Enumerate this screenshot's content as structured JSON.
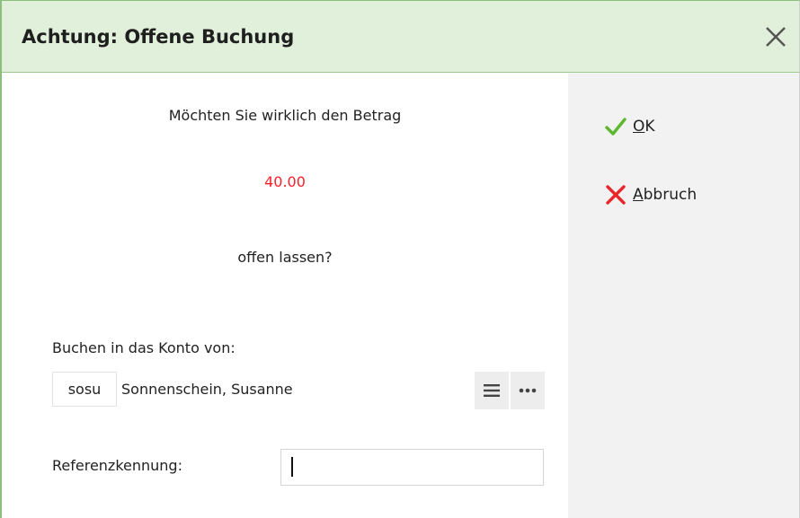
{
  "dialog": {
    "title": "Achtung: Offene Buchung",
    "close_icon": "close-icon"
  },
  "message": {
    "line1": "Möchten Sie wirklich den Betrag",
    "amount": "40.00",
    "amount_color": "#ff1f2b",
    "line3": "offen lassen?"
  },
  "account": {
    "label": "Buchen in das Konto von:",
    "code": "sosu",
    "name": "Sonnenschein, Susanne",
    "list_icon": "list-icon",
    "more_icon": "more-icon"
  },
  "reference": {
    "label": "Referenzkennung:",
    "value": ""
  },
  "actions": {
    "ok": {
      "accel": "O",
      "rest": "K",
      "icon": "checkmark-icon",
      "color": "#5cb82e"
    },
    "cancel": {
      "accel": "A",
      "rest": "bbruch",
      "icon": "cross-icon",
      "color": "#e8262b"
    }
  },
  "colors": {
    "title_bg": "#e1f0da",
    "title_border": "#8cc07a",
    "side_panel_bg": "#f2f2f2"
  }
}
